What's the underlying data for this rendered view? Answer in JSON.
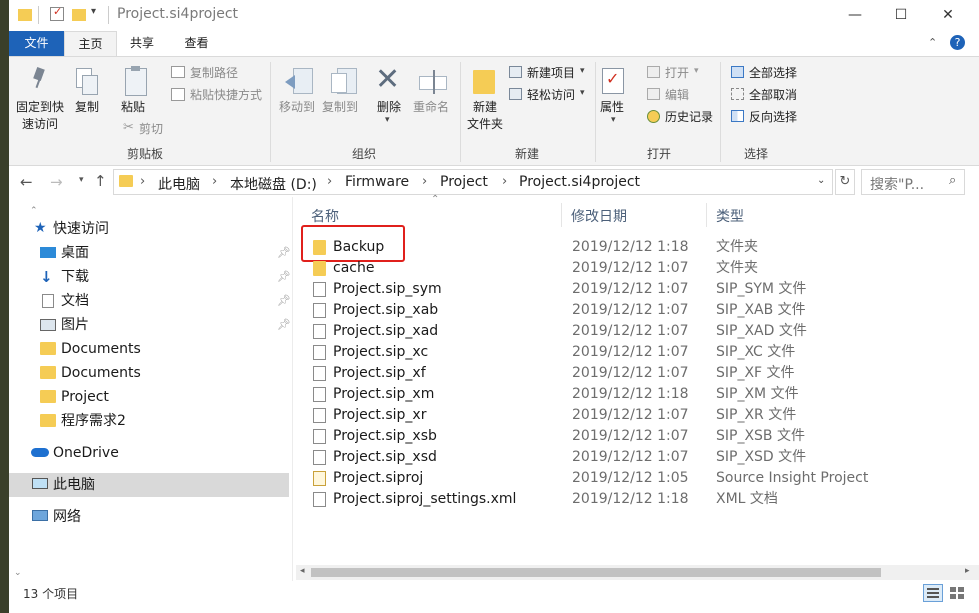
{
  "window": {
    "title": "Project.si4project",
    "controls": [
      "—",
      "☐",
      "✕"
    ]
  },
  "ribbon_tabs": [
    "文件",
    "主页",
    "共享",
    "查看"
  ],
  "ribbon": {
    "clipboard": {
      "pin": "固定到快\n速访问",
      "copy": "复制",
      "paste": "粘贴",
      "copy_path": "复制路径",
      "paste_shortcut": "粘贴快捷方式",
      "cut": "剪切",
      "label": "剪贴板"
    },
    "organize": {
      "move_to": "移动到",
      "copy_to": "复制到",
      "delete": "删除",
      "rename": "重命名",
      "label": "组织"
    },
    "new": {
      "new_folder": "新建\n文件夹",
      "new_item": "新建项目",
      "easy_access": "轻松访问",
      "label": "新建"
    },
    "open": {
      "properties": "属性",
      "open": "打开",
      "edit": "编辑",
      "history": "历史记录",
      "label": "打开"
    },
    "select": {
      "select_all": "全部选择",
      "select_none": "全部取消",
      "invert": "反向选择",
      "label": "选择"
    }
  },
  "address": {
    "breadcrumbs": [
      "此电脑",
      "本地磁盘 (D:)",
      "Firmware",
      "Project",
      "Project.si4project"
    ],
    "search_placeholder": "搜索\"P..."
  },
  "nav": {
    "quick_access": "快速访问",
    "items": [
      {
        "label": "桌面",
        "pinned": true
      },
      {
        "label": "下载",
        "pinned": true
      },
      {
        "label": "文档",
        "pinned": true
      },
      {
        "label": "图片",
        "pinned": true
      },
      {
        "label": "Documents",
        "pinned": false
      },
      {
        "label": "Documents",
        "pinned": false
      },
      {
        "label": "Project",
        "pinned": false
      },
      {
        "label": "程序需求2",
        "pinned": false
      }
    ],
    "onedrive": "OneDrive",
    "this_pc": "此电脑",
    "network": "网络"
  },
  "columns": {
    "name": "名称",
    "date": "修改日期",
    "type": "类型"
  },
  "files": [
    {
      "name": "Backup",
      "date": "2019/12/12 1:18",
      "type": "文件夹",
      "kind": "folder"
    },
    {
      "name": "cache",
      "date": "2019/12/12 1:07",
      "type": "文件夹",
      "kind": "folder"
    },
    {
      "name": "Project.sip_sym",
      "date": "2019/12/12 1:07",
      "type": "SIP_SYM 文件",
      "kind": "file"
    },
    {
      "name": "Project.sip_xab",
      "date": "2019/12/12 1:07",
      "type": "SIP_XAB 文件",
      "kind": "file"
    },
    {
      "name": "Project.sip_xad",
      "date": "2019/12/12 1:07",
      "type": "SIP_XAD 文件",
      "kind": "file"
    },
    {
      "name": "Project.sip_xc",
      "date": "2019/12/12 1:07",
      "type": "SIP_XC 文件",
      "kind": "file"
    },
    {
      "name": "Project.sip_xf",
      "date": "2019/12/12 1:07",
      "type": "SIP_XF 文件",
      "kind": "file"
    },
    {
      "name": "Project.sip_xm",
      "date": "2019/12/12 1:18",
      "type": "SIP_XM 文件",
      "kind": "file"
    },
    {
      "name": "Project.sip_xr",
      "date": "2019/12/12 1:07",
      "type": "SIP_XR 文件",
      "kind": "file"
    },
    {
      "name": "Project.sip_xsb",
      "date": "2019/12/12 1:07",
      "type": "SIP_XSB 文件",
      "kind": "file"
    },
    {
      "name": "Project.sip_xsd",
      "date": "2019/12/12 1:07",
      "type": "SIP_XSD 文件",
      "kind": "file"
    },
    {
      "name": "Project.siproj",
      "date": "2019/12/12 1:05",
      "type": "Source Insight Project",
      "kind": "siproj"
    },
    {
      "name": "Project.siproj_settings.xml",
      "date": "2019/12/12 1:18",
      "type": "XML 文档",
      "kind": "file"
    }
  ],
  "status": "13 个项目",
  "colors": {
    "accent": "#1e63b8",
    "highlight_box": "#e0201c",
    "folder": "#f5cc55",
    "selected_nav": "#d9d9d9"
  }
}
